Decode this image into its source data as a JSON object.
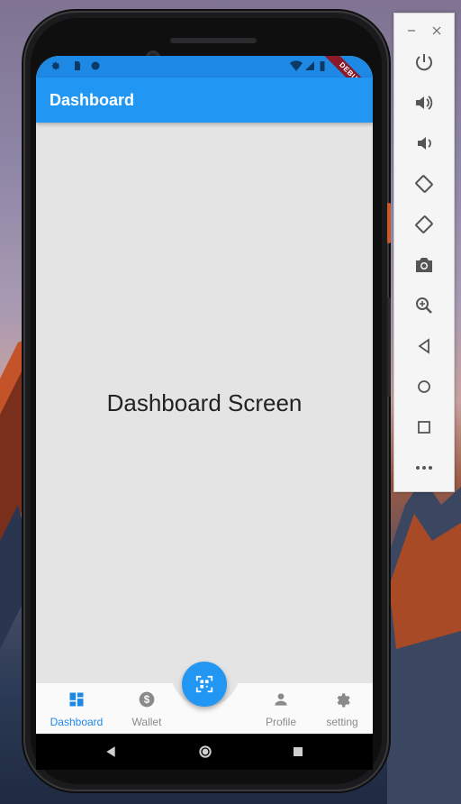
{
  "app": {
    "title": "Dashboard",
    "debug_banner": "DEBUG",
    "content_text": "Dashboard Screen",
    "accent_color": "#2196f3"
  },
  "status_bar": {
    "icons": [
      "settings-icon",
      "sim-icon",
      "sync-icon",
      "wifi-icon",
      "signal-icon",
      "battery-icon"
    ]
  },
  "bottom_nav": {
    "items": [
      {
        "label": "Dashboard",
        "icon": "dashboard-icon",
        "active": true
      },
      {
        "label": "Wallet",
        "icon": "dollar-icon",
        "active": false
      },
      {
        "label": "Profile",
        "icon": "person-icon",
        "active": false
      },
      {
        "label": "setting",
        "icon": "gear-icon",
        "active": false
      }
    ],
    "fab_icon": "qr-scan-icon"
  },
  "system_nav": [
    "back-icon",
    "home-icon",
    "recents-icon"
  ],
  "emulator_toolbar": {
    "window_controls": [
      "minimize-icon",
      "close-icon"
    ],
    "buttons": [
      "power-icon",
      "volume-up-icon",
      "volume-down-icon",
      "rotate-left-icon",
      "rotate-right-icon",
      "camera-icon",
      "zoom-icon",
      "back-icon",
      "home-icon",
      "overview-icon",
      "more-icon"
    ]
  }
}
